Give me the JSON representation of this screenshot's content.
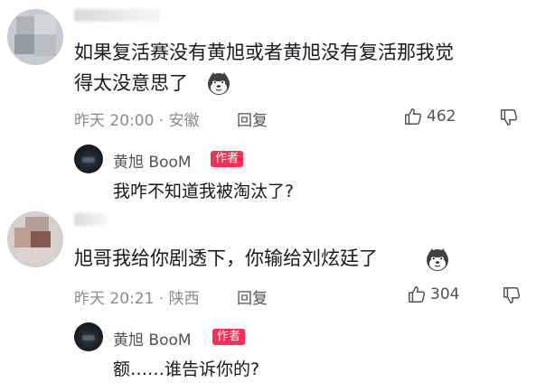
{
  "comments": [
    {
      "text": "如果复活赛没有黄旭或者黄旭没有复活那我觉",
      "text_line2": "得太没意思了",
      "emoji": "dog-emoji",
      "time_location": "昨天 20:00 · 安徽",
      "reply_label": "回复",
      "likes": "462",
      "author_reply": {
        "author": "黄旭 BooM",
        "badge": "作者",
        "text": "我咋不知道我被淘汰了?"
      }
    },
    {
      "text": "旭哥我给你剧透下，你输给刘炫廷了",
      "emoji": "dog-emoji",
      "time_location": "昨天 20:21 · 陕西",
      "reply_label": "回复",
      "likes": "304",
      "author_reply": {
        "author": "黄旭 BooM",
        "badge": "作者",
        "text": "额……谁告诉你的?"
      }
    }
  ],
  "icons": {
    "like": "thumb-up-icon",
    "dislike": "thumb-down-icon"
  },
  "colors": {
    "badge": "#fe2c55",
    "meta_text": "#8a8b91",
    "primary_text": "#161823"
  }
}
